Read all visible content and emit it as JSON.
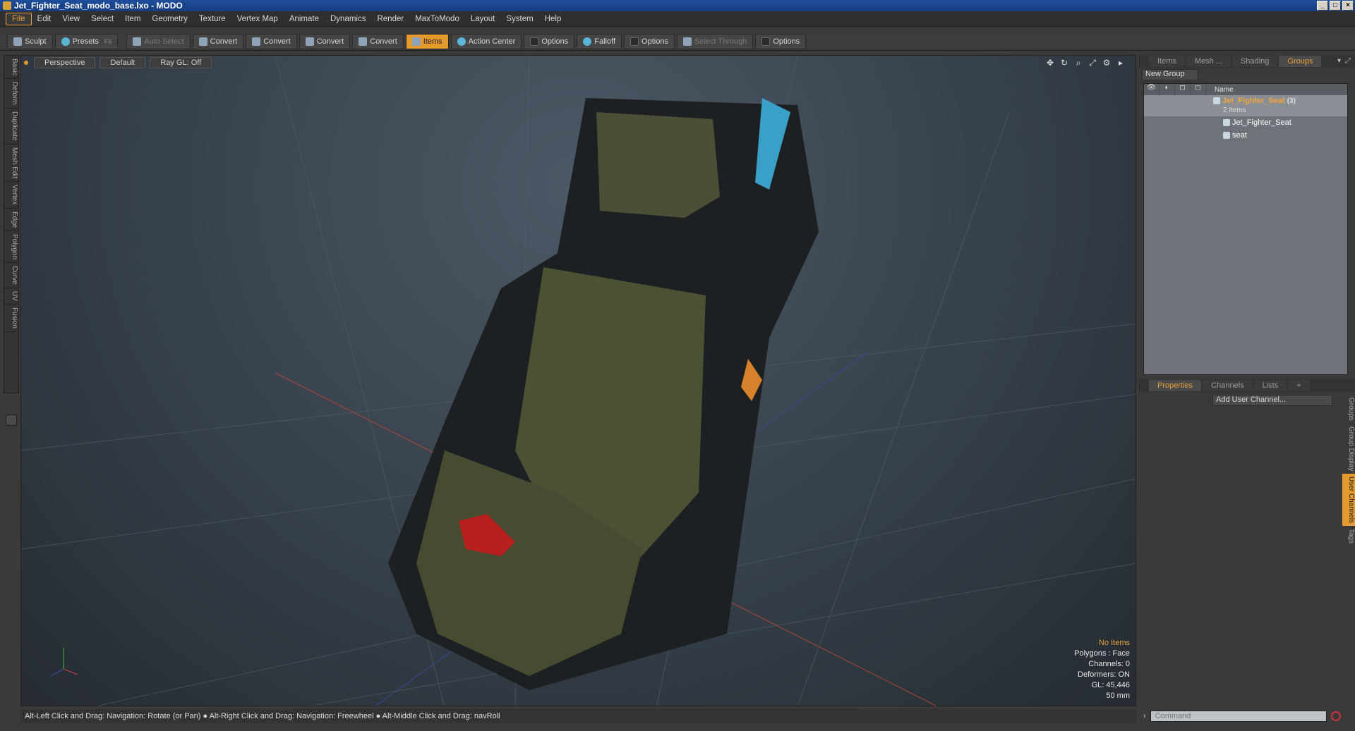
{
  "window": {
    "title": "Jet_Fighter_Seat_modo_base.lxo - MODO"
  },
  "menu": [
    "File",
    "Edit",
    "View",
    "Select",
    "Item",
    "Geometry",
    "Texture",
    "Vertex Map",
    "Animate",
    "Dynamics",
    "Render",
    "MaxToModo",
    "Layout",
    "System",
    "Help"
  ],
  "toolbar": {
    "sculpt": "Sculpt",
    "presets": "Presets",
    "presets_key": "F6",
    "auto_select": "Auto Select",
    "convert1": "Convert",
    "convert2": "Convert",
    "convert3": "Convert",
    "convert4": "Convert",
    "items": "Items",
    "action_center": "Action Center",
    "options1": "Options",
    "falloff": "Falloff",
    "options2": "Options",
    "select_through": "Select Through",
    "options3": "Options"
  },
  "left_tabs": [
    "Basic",
    "Deform",
    "Duplicate",
    "Mesh Edit",
    "Vertex",
    "Edge",
    "Polygon",
    "Curve",
    "UV",
    "Fusion"
  ],
  "viewport": {
    "view": "Perspective",
    "shading": "Default",
    "raygl": "Ray GL: Off",
    "info": {
      "items": "No Items",
      "polygons": "Polygons : Face",
      "channels": "Channels: 0",
      "deformers": "Deformers: ON",
      "gl": "GL: 45,446",
      "focal": "50 mm"
    }
  },
  "status": "Alt-Left Click and Drag: Navigation: Rotate (or Pan) ● Alt-Right Click and Drag: Navigation: Freewheel ● Alt-Middle Click and Drag: navRoll",
  "right_panel": {
    "tabs": [
      "Items",
      "Mesh ...",
      "Shading",
      "Groups"
    ],
    "new_group": "New Group",
    "name_header": "Name",
    "group_name": "Jet_Fighter_Seat",
    "group_count": "(3)",
    "group_items": "2 Items",
    "child1": "Jet_Fighter_Seat",
    "child2": "seat",
    "tabs2": [
      "Properties",
      "Channels",
      "Lists",
      "+"
    ],
    "add_channel": "Add User Channel...",
    "side_tabs": [
      "Groups",
      "Group Display",
      "User Channels",
      "Tags"
    ]
  },
  "command": {
    "placeholder": "Command"
  }
}
